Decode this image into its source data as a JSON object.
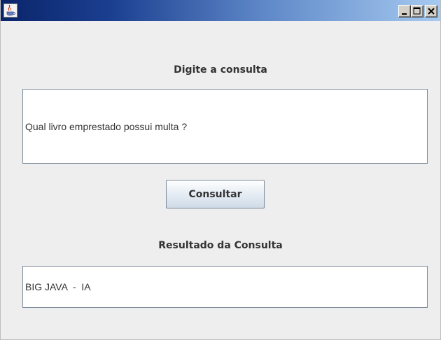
{
  "window": {
    "title": "",
    "icon": "java-cup-icon",
    "controls": {
      "minimize": "minimize-icon",
      "maximize": "maximize-icon",
      "close": "close-icon"
    }
  },
  "query": {
    "label": "Digite a consulta",
    "value": "Qual livro emprestado possui multa ?"
  },
  "actions": {
    "consult_label": "Consultar"
  },
  "result": {
    "label": "Resultado da Consulta",
    "value": "BIG JAVA  -  IA"
  },
  "colors": {
    "titlebar_start": "#0a246a",
    "titlebar_end": "#a6caf0",
    "window_bg": "#eeeeee",
    "field_border": "#7a8a99"
  }
}
